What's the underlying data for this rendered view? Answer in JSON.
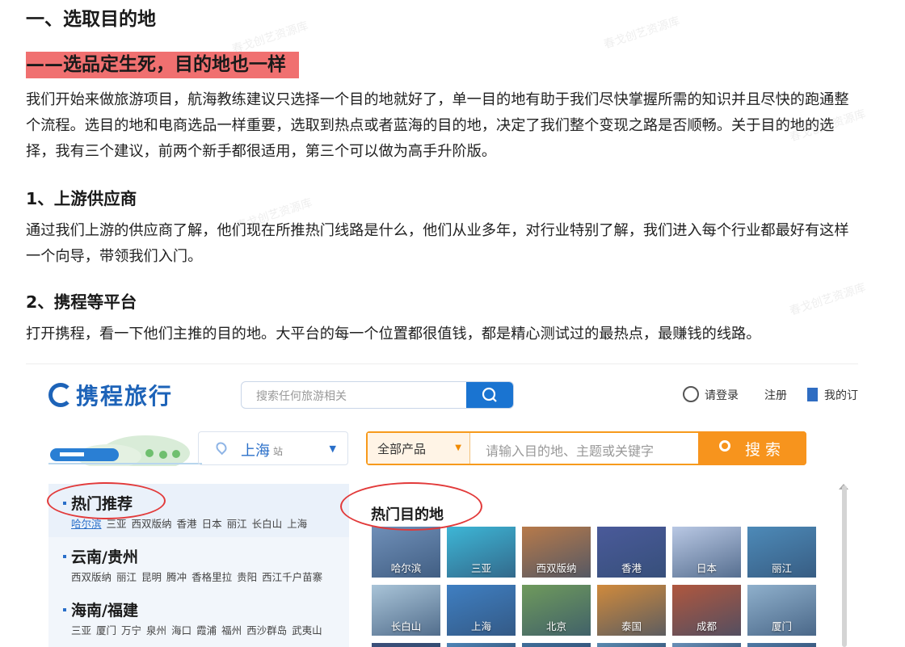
{
  "article": {
    "heading": "一、选取目的地",
    "highlight": "——选品定生死，目的地也一样",
    "intro": "我们开始来做旅游项目，航海教练建议只选择一个目的地就好了，单一目的地有助于我们尽快掌握所需的知识并且尽快的跑通整个流程。选目的地和电商选品一样重要，选取到热点或者蓝海的目的地，决定了我们整个变现之路是否顺畅。关于目的地的选择，我有三个建议，前两个新手都很适用，第三个可以做为高手升阶版。",
    "section1_title": "1、上游供应商",
    "section1_text": "通过我们上游的供应商了解，他们现在所推热门线路是什么，他们从业多年，对行业特别了解，我们进入每个行业都最好有这样一个向导，带领我们入门。",
    "section2_title": "2、携程等平台",
    "section2_text": "打开携程，看一下他们主推的目的地。大平台的每一个位置都很值钱，都是精心测试过的最热点，最赚钱的线路。",
    "watermark": "春戈创艺资源库"
  },
  "ctrip": {
    "logo": "携程旅行",
    "search_placeholder": "搜索任何旅游相关",
    "login": "请登录",
    "register": "注册",
    "my": "我的订",
    "city": "上海",
    "city_suffix": "站",
    "category": "全部产品",
    "main_search_placeholder": "请输入目的地、主题或关键字",
    "main_search_button": "搜索",
    "sidebar": [
      {
        "title": "热门推荐",
        "items": [
          "哈尔滨",
          "三亚",
          "西双版纳",
          "香港",
          "日本",
          "丽江",
          "长白山",
          "上海"
        ]
      },
      {
        "title": "云南/贵州",
        "items": [
          "西双版纳",
          "丽江",
          "昆明",
          "腾冲",
          "香格里拉",
          "贵阳",
          "西江千户苗寨"
        ]
      },
      {
        "title": "海南/福建",
        "items": [
          "三亚",
          "厦门",
          "万宁",
          "泉州",
          "海口",
          "霞浦",
          "福州",
          "西沙群岛",
          "武夷山"
        ]
      }
    ],
    "hot_title": "热门目的地",
    "destinations": [
      {
        "name": "哈尔滨",
        "color": "#6f8fb8"
      },
      {
        "name": "三亚",
        "color": "#3db6d6"
      },
      {
        "name": "西双版纳",
        "color": "#b77a4a"
      },
      {
        "name": "香港",
        "color": "#4a5a9a"
      },
      {
        "name": "日本",
        "color": "#b9c8e4"
      },
      {
        "name": "丽江",
        "color": "#4d8ab8"
      },
      {
        "name": "长白山",
        "color": "#a9c4d8"
      },
      {
        "name": "上海",
        "color": "#3f7fc2"
      },
      {
        "name": "北京",
        "color": "#6f9a5c"
      },
      {
        "name": "泰国",
        "color": "#d08a3c"
      },
      {
        "name": "成都",
        "color": "#b0573e"
      },
      {
        "name": "厦门",
        "color": "#8fb0cc"
      },
      {
        "name": "",
        "color": "#3b4f7a"
      },
      {
        "name": "",
        "color": "#4e86b8"
      },
      {
        "name": "",
        "color": "#3f6e9a"
      },
      {
        "name": "",
        "color": "#5a8ab0"
      },
      {
        "name": "",
        "color": "#6a90b8"
      },
      {
        "name": "",
        "color": "#4f7aa6"
      }
    ]
  }
}
